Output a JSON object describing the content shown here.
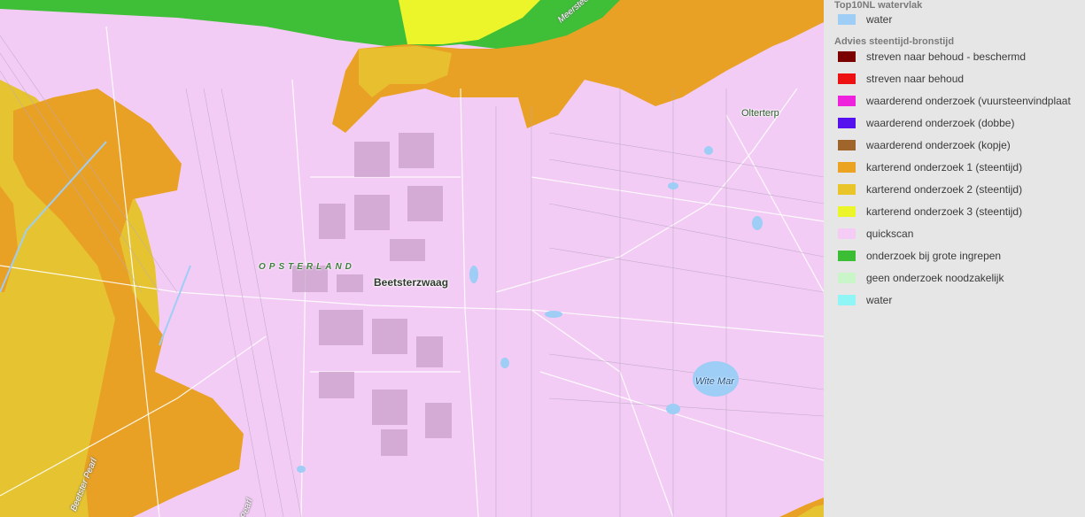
{
  "map": {
    "labels": {
      "municipality": "OPSTERLAND",
      "town": "Beetsterzwaag",
      "village": "Olterterp",
      "lake": "Wite Mar",
      "road_top": "Meerstee",
      "road_bottom_left": "Beetster Pearl",
      "road_bottom_mid": "Pearl"
    }
  },
  "legend": {
    "group1_title": "Top10NL watervlak",
    "group1_items": [
      {
        "label": "water",
        "color": "#9ecdf5"
      }
    ],
    "group2_title": "Advies steentijd-bronstijd",
    "group2_items": [
      {
        "label": "streven naar behoud - beschermd",
        "color": "#7b0000"
      },
      {
        "label": "streven naar behoud",
        "color": "#ee1111"
      },
      {
        "label": "waarderend onderzoek (vuursteenvindplaat",
        "color": "#ee22dd"
      },
      {
        "label": "waarderend onderzoek (dobbe)",
        "color": "#5511ee"
      },
      {
        "label": "waarderend onderzoek (kopje)",
        "color": "#a0652b"
      },
      {
        "label": "karterend onderzoek 1 (steentijd)",
        "color": "#eba321"
      },
      {
        "label": "karterend onderzoek 2 (steentijd)",
        "color": "#e9c52a"
      },
      {
        "label": "karterend onderzoek 3 (steentijd)",
        "color": "#ecf52a"
      },
      {
        "label": "quickscan",
        "color": "#f4ccf6"
      },
      {
        "label": "onderzoek bij grote ingrepen",
        "color": "#3cbe34"
      },
      {
        "label": "geen onderzoek noodzakelijk",
        "color": "#c9f5c9"
      },
      {
        "label": "water",
        "color": "#90f5f5"
      }
    ]
  }
}
